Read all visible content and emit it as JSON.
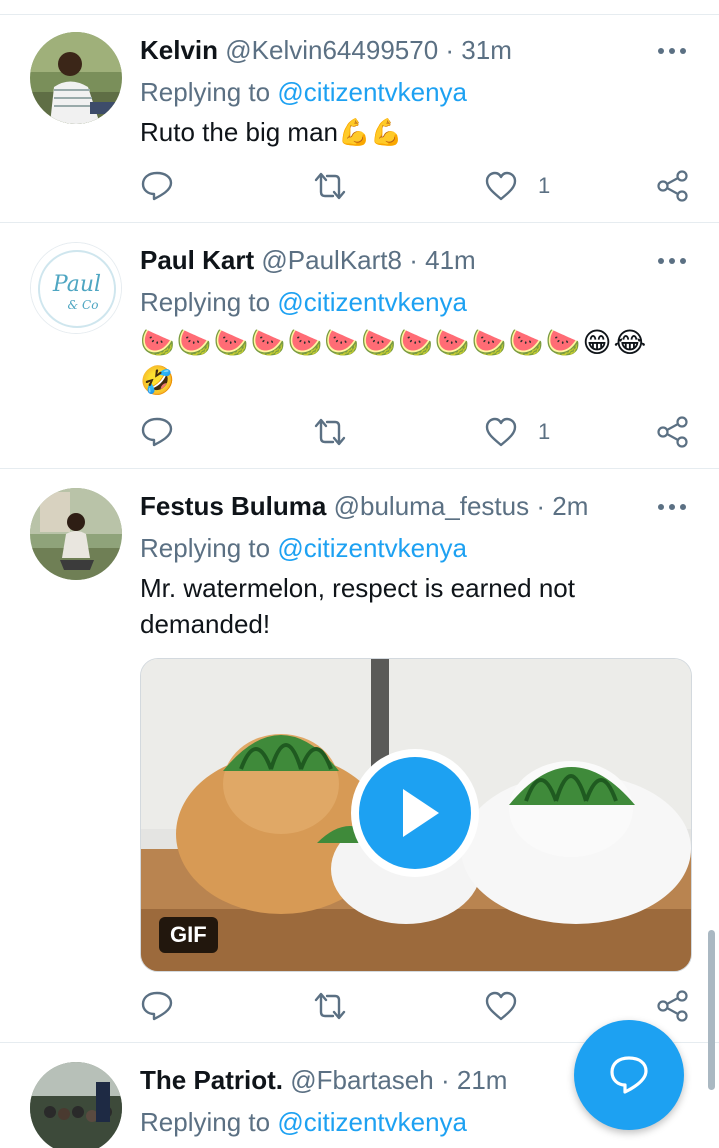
{
  "tweets": [
    {
      "name": "Kelvin",
      "handle": "@Kelvin64499570",
      "dot": "·",
      "time": "31m",
      "replying_prefix": "Replying to",
      "replying_to": "@citizentvkenya",
      "text": "Ruto the big man💪💪",
      "likes": "1"
    },
    {
      "name": "Paul Kart",
      "handle": "@PaulKart8",
      "dot": "·",
      "time": "41m",
      "replying_prefix": "Replying to",
      "replying_to": "@citizentvkenya",
      "text": "🍉🍉🍉🍉🍉🍉🍉🍉🍉🍉🍉🍉😁😂🤣",
      "likes": "1",
      "avatar_logo_text": "Paul & Co"
    },
    {
      "name": "Festus Buluma",
      "handle": "@buluma_festus",
      "dot": "·",
      "time": "2m",
      "replying_prefix": "Replying to",
      "replying_to": "@citizentvkenya",
      "text": "Mr. watermelon, respect is earned not demanded!",
      "media_badge": "GIF",
      "likes": ""
    },
    {
      "name": "The Patriot.",
      "handle": "@Fbartaseh",
      "dot": "·",
      "time": "21m",
      "replying_prefix": "Replying to",
      "replying_to": "@citizentvkenya"
    }
  ],
  "icons": {
    "reply": "reply-icon",
    "retweet": "retweet-icon",
    "like": "heart-icon",
    "share": "share-icon",
    "more": "more-options-icon",
    "compose": "compose-reply-icon",
    "play": "play-icon"
  },
  "colors": {
    "accent": "#1da1f2",
    "secondary_text": "#5b7083",
    "divider": "#e6ecf0"
  }
}
